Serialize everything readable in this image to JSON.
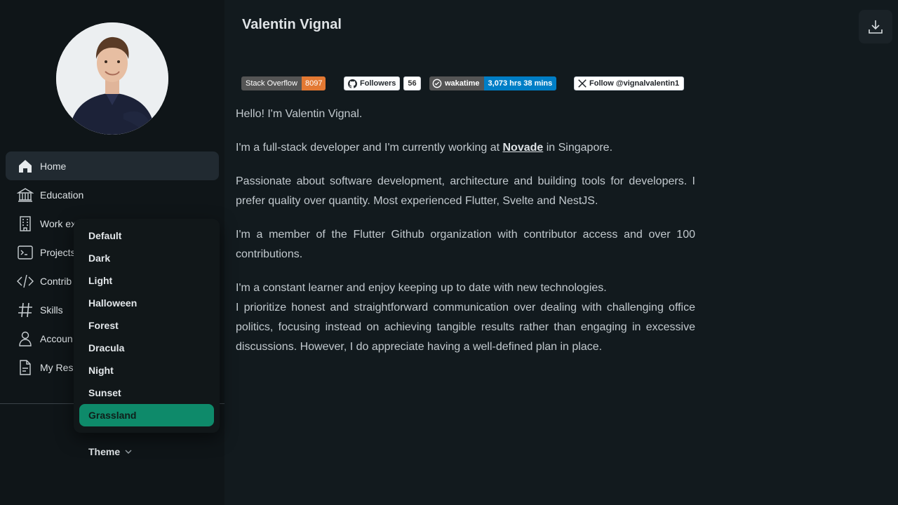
{
  "profile": {
    "name": "Valentin Vignal"
  },
  "nav": {
    "items": [
      {
        "label": "Home",
        "icon": "home-icon"
      },
      {
        "label": "Education",
        "icon": "education-icon"
      },
      {
        "label": "Work ex",
        "icon": "building-icon"
      },
      {
        "label": "Projects",
        "icon": "terminal-icon"
      },
      {
        "label": "Contrib",
        "icon": "code-icon"
      },
      {
        "label": "Skills",
        "icon": "hash-icon"
      },
      {
        "label": "Accoun",
        "icon": "user-icon"
      },
      {
        "label": "My Res",
        "icon": "document-icon"
      }
    ]
  },
  "theme": {
    "toggle_label": "Theme",
    "options": [
      "Default",
      "Dark",
      "Light",
      "Halloween",
      "Forest",
      "Dracula",
      "Night",
      "Sunset",
      "Grassland"
    ],
    "selected": "Grassland"
  },
  "badges": {
    "stackoverflow": {
      "label": "Stack Overflow",
      "value": "8097"
    },
    "github": {
      "label": "Followers",
      "value": "56"
    },
    "wakatime": {
      "label": "wakatime",
      "value": "3,073 hrs 38 mins"
    },
    "x": {
      "label": "Follow @vignalvalentin1"
    }
  },
  "about": {
    "p1": "Hello! I'm Valentin Vignal.",
    "p2_before": "I'm a full-stack developer and I'm currently working at ",
    "p2_link": "Novade",
    "p2_after": " in Singapore.",
    "p3": "Passionate about software development, architecture and building tools for developers. I prefer quality over quantity. Most experienced Flutter, Svelte and NestJS.",
    "p4": "I'm a member of the Flutter Github organization with contributor access and over 100 contributions.",
    "p5_line1": "I'm a constant learner and enjoy keeping up to date with new technologies.",
    "p5_line2": "I prioritize honest and straightforward communication over dealing with challenging office politics, focusing instead on achieving tangible results rather than engaging in excessive discussions. However, I do appreciate having a well-defined plan in place."
  },
  "colors": {
    "accent": "#0e8a6a",
    "background": "#121a1e",
    "sidebar": "#0f1518"
  }
}
